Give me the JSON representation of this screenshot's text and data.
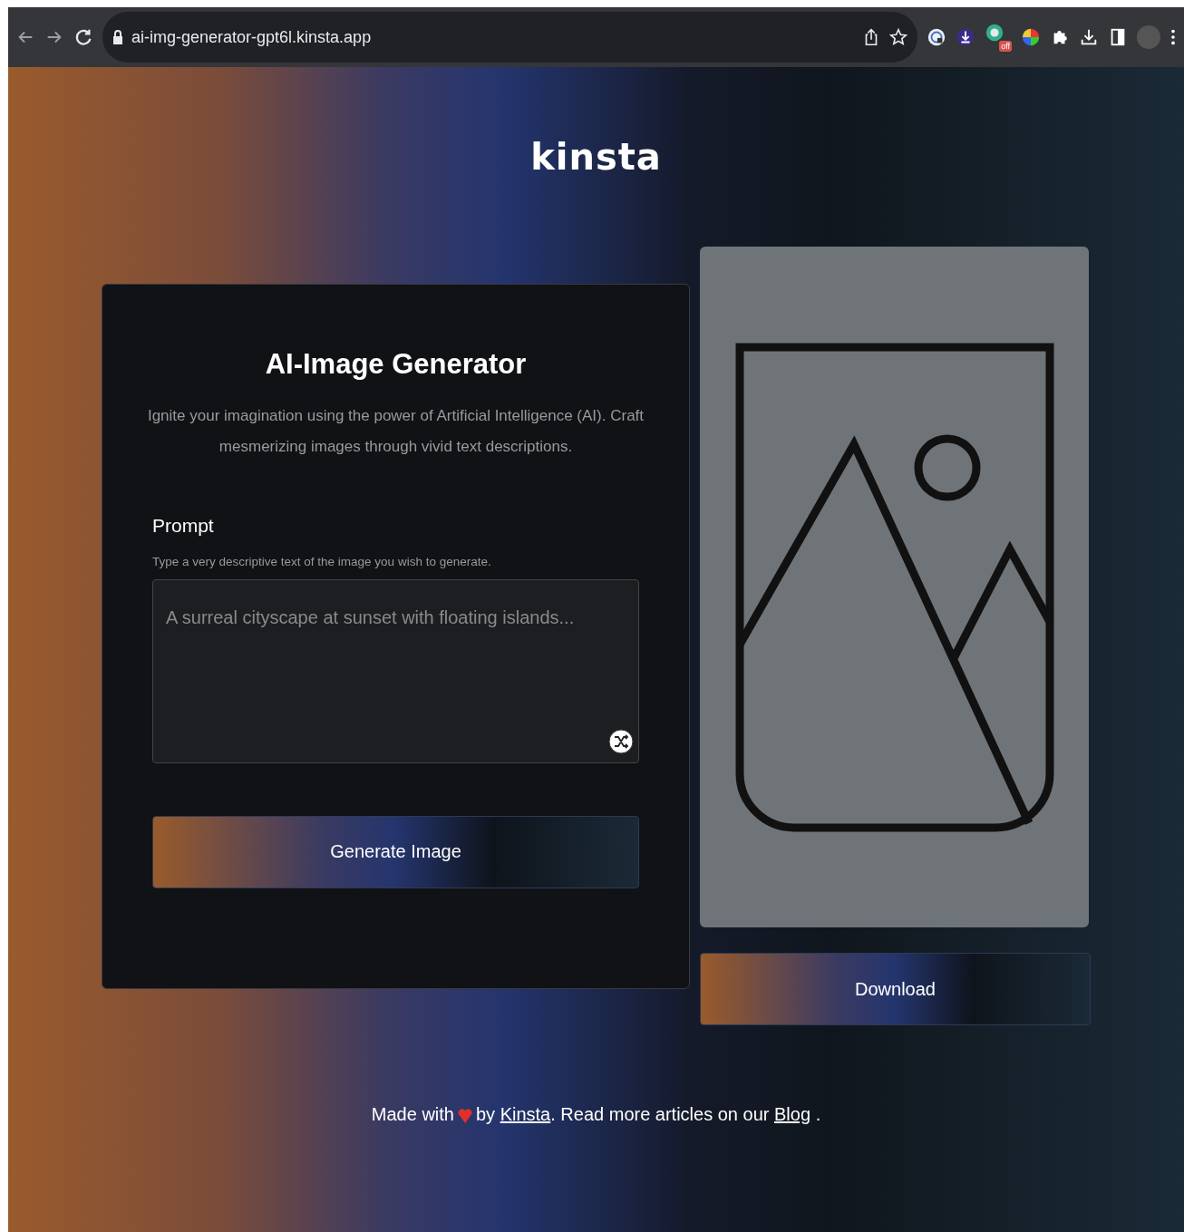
{
  "browser": {
    "url": "ai-img-generator-gpt6l.kinsta.app",
    "extension_badge": "off"
  },
  "logo": "kinsta",
  "card": {
    "title": "AI-Image Generator",
    "subtitle": "Ignite your imagination using the power of Artificial Intelligence (AI). Craft mesmerizing images through vivid text descriptions.",
    "prompt_label": "Prompt",
    "prompt_hint": "Type a very descriptive text of the image you wish to generate.",
    "prompt_placeholder": "A surreal cityscape at sunset with floating islands...",
    "button": "Generate Image"
  },
  "preview": {
    "button": "Download"
  },
  "footer": {
    "before": "Made with",
    "by": "by",
    "link": "Kinsta",
    "middle": ". Read more articles on our",
    "blog_link": "Blog",
    "end": "."
  }
}
